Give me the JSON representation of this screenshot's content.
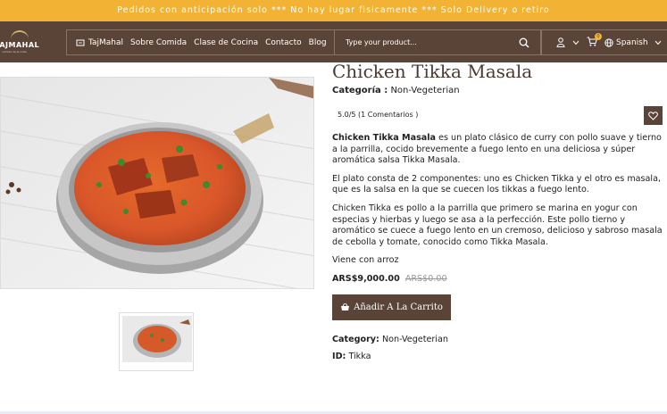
{
  "topbar": {
    "text": "Pedidos con anticipación solo *** No hay lugar fisicamente *** Solo Delivery o retiro"
  },
  "logo": {
    "name": "TAJMAHAL",
    "subtitle": "comida de la india"
  },
  "menu": {
    "items": [
      {
        "label": "TajMahal",
        "icon": "store-icon"
      },
      {
        "label": "Sobre Comida"
      },
      {
        "label": "Clase de Cocina"
      },
      {
        "label": "Contacto"
      },
      {
        "label": "Blog"
      }
    ]
  },
  "search": {
    "placeholder": "Type your product..."
  },
  "tools": {
    "language": "Spanish",
    "cart_count": "0"
  },
  "product": {
    "title": "Chicken Tikka Masala",
    "category_label": "Categoría :",
    "category": "Non-Vegeterian",
    "rating": "5.0/5 (1 Comentarios )",
    "desc": {
      "p1_bold": "Chicken Tikka Masala",
      "p1_rest": " es un plato clásico de curry con pollo suave y tierno a la parrilla, cocido brevemente a fuego lento en una deliciosa y súper aromática salsa Tikka Masala.",
      "p2": "El plato consta de 2 componentes: uno es Chicken Tikka y el otro es masala, que es la salsa en la que se cuecen los tikkas a fuego lento.",
      "p3": "Chicken Tikka es pollo a la parrilla que primero se marina en yogur con especias y hierbas y luego se asa a la perfección. Este pollo tierno y aromático se cuece a fuego lento en un cremoso, delicioso y sabroso masala de cebolla y tomate, conocido como Tikka Masala.",
      "p4": "Viene con arroz"
    },
    "price": "ARS$9,000.00",
    "old_price": "ARS$0.00",
    "add_to_cart": "Añadir A La Carrito",
    "category_en_label": "Category:",
    "category_en": "Non-Vegeterian",
    "id_label": "ID:",
    "id": "Tikka"
  },
  "colors": {
    "brand": "#5a4438",
    "accent": "#f2b233"
  }
}
